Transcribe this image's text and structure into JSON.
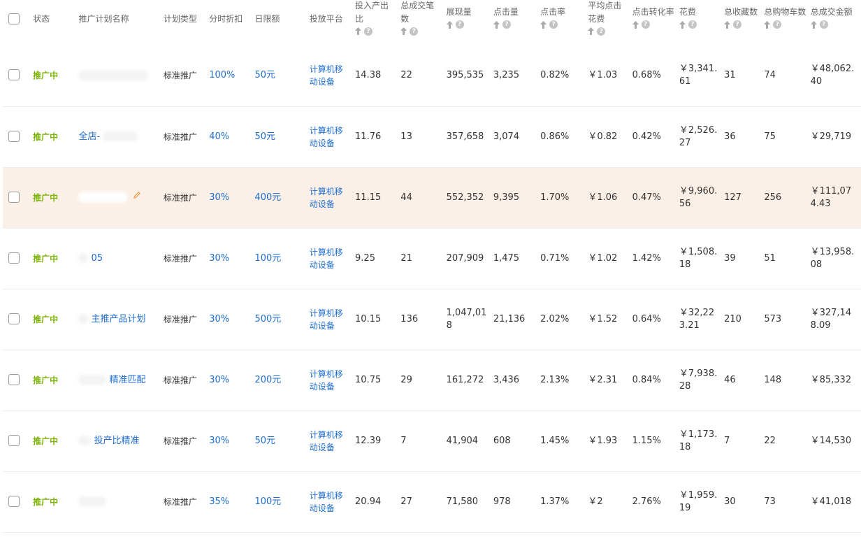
{
  "header": {
    "status": "状态",
    "name": "推广计划名称",
    "type": "计划类型",
    "discount": "分时折扣",
    "budget": "日限额",
    "platform": "投放平台",
    "roi": "投入产出比",
    "orders": "总成交笔数",
    "impressions": "展现量",
    "clicks": "点击量",
    "ctr": "点击率",
    "cpc": "平均点击花费",
    "cvr": "点击转化率",
    "cost": "花费",
    "favorites": "总收藏数",
    "carts": "总购物车数",
    "gmv": "总成交金额"
  },
  "rows": [
    {
      "status": "推广中",
      "name": "",
      "type": "标准推广",
      "discount": "100%",
      "budget": "50元",
      "platform": "计算机移动设备",
      "roi": "14.38",
      "orders": "22",
      "impressions": "395,535",
      "clicks": "3,235",
      "ctr": "0.82%",
      "cpc": "￥1.03",
      "cvr": "0.68%",
      "cost": "￥3,341.61",
      "favorites": "31",
      "carts": "74",
      "gmv": "￥48,062.40"
    },
    {
      "status": "推广中",
      "name": "全店-",
      "type": "标准推广",
      "discount": "40%",
      "budget": "50元",
      "platform": "计算机移动设备",
      "roi": "11.76",
      "orders": "13",
      "impressions": "357,658",
      "clicks": "3,074",
      "ctr": "0.86%",
      "cpc": "￥0.82",
      "cvr": "0.42%",
      "cost": "￥2,526.27",
      "favorites": "36",
      "carts": "75",
      "gmv": "￥29,719"
    },
    {
      "status": "推广中",
      "name": "",
      "type": "标准推广",
      "discount": "30%",
      "budget": "400元",
      "platform": "计算机移动设备",
      "roi": "11.15",
      "orders": "44",
      "impressions": "552,352",
      "clicks": "9,395",
      "ctr": "1.70%",
      "cpc": "￥1.06",
      "cvr": "0.47%",
      "cost": "￥9,960.56",
      "favorites": "127",
      "carts": "256",
      "gmv": "￥111,074.43"
    },
    {
      "status": "推广中",
      "name": "05",
      "type": "标准推广",
      "discount": "30%",
      "budget": "100元",
      "platform": "计算机移动设备",
      "roi": "9.25",
      "orders": "21",
      "impressions": "207,909",
      "clicks": "1,475",
      "ctr": "0.71%",
      "cpc": "￥1.02",
      "cvr": "1.42%",
      "cost": "￥1,508.18",
      "favorites": "39",
      "carts": "51",
      "gmv": "￥13,958.08"
    },
    {
      "status": "推广中",
      "name": "主推产品计划",
      "type": "标准推广",
      "discount": "30%",
      "budget": "500元",
      "platform": "计算机移动设备",
      "roi": "10.15",
      "orders": "136",
      "impressions": "1,047,018",
      "clicks": "21,136",
      "ctr": "2.02%",
      "cpc": "￥1.52",
      "cvr": "0.64%",
      "cost": "￥32,223.21",
      "favorites": "210",
      "carts": "573",
      "gmv": "￥327,148.09"
    },
    {
      "status": "推广中",
      "name": "精准匹配",
      "type": "标准推广",
      "discount": "30%",
      "budget": "200元",
      "platform": "计算机移动设备",
      "roi": "10.75",
      "orders": "29",
      "impressions": "161,272",
      "clicks": "3,436",
      "ctr": "2.13%",
      "cpc": "￥2.31",
      "cvr": "0.84%",
      "cost": "￥7,938.28",
      "favorites": "46",
      "carts": "148",
      "gmv": "￥85,332"
    },
    {
      "status": "推广中",
      "name": "投产比精准",
      "type": "标准推广",
      "discount": "30%",
      "budget": "50元",
      "platform": "计算机移动设备",
      "roi": "12.39",
      "orders": "7",
      "impressions": "41,904",
      "clicks": "608",
      "ctr": "1.45%",
      "cpc": "￥1.93",
      "cvr": "1.15%",
      "cost": "￥1,173.18",
      "favorites": "7",
      "carts": "22",
      "gmv": "￥14,530"
    },
    {
      "status": "推广中",
      "name": "",
      "type": "标准推广",
      "discount": "35%",
      "budget": "100元",
      "platform": "计算机移动设备",
      "roi": "20.94",
      "orders": "27",
      "impressions": "71,580",
      "clicks": "978",
      "ctr": "1.37%",
      "cpc": "￥2",
      "cvr": "2.76%",
      "cost": "￥1,959.19",
      "favorites": "30",
      "carts": "73",
      "gmv": "￥41,018"
    }
  ],
  "icons": {
    "sort": "arrow-up-icon",
    "help": "question-icon",
    "edit": "pencil-icon"
  },
  "colors": {
    "status": "#7cb305",
    "link": "#1f6ecf",
    "highlight_row": "#fbf0e8"
  }
}
